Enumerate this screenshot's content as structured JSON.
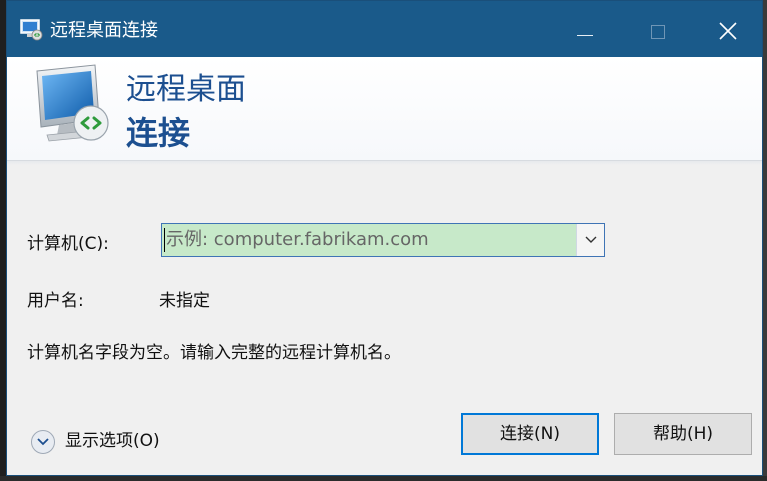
{
  "window": {
    "title": "远程桌面连接",
    "minimize_icon": "minimize-icon",
    "maximize_icon": "maximize-icon",
    "close_icon": "close-icon"
  },
  "banner": {
    "line1": "远程桌面",
    "line2": "连接",
    "icon": "remote-desktop-icon"
  },
  "form": {
    "computer_label": "计算机(C):",
    "computer_placeholder": "示例: computer.fabrikam.com",
    "computer_value": "",
    "username_label": "用户名:",
    "username_value": "未指定",
    "message": "计算机名字段为空。请输入完整的远程计算机名。"
  },
  "footer": {
    "options_label": "显示选项(O)",
    "connect_label": "连接(N)",
    "help_label": "帮助(H)"
  },
  "colors": {
    "titlebar": "#1a5a8a",
    "banner_text": "#1c4f90",
    "input_highlight": "#c7e9c9",
    "focus_border": "#0078d7"
  }
}
